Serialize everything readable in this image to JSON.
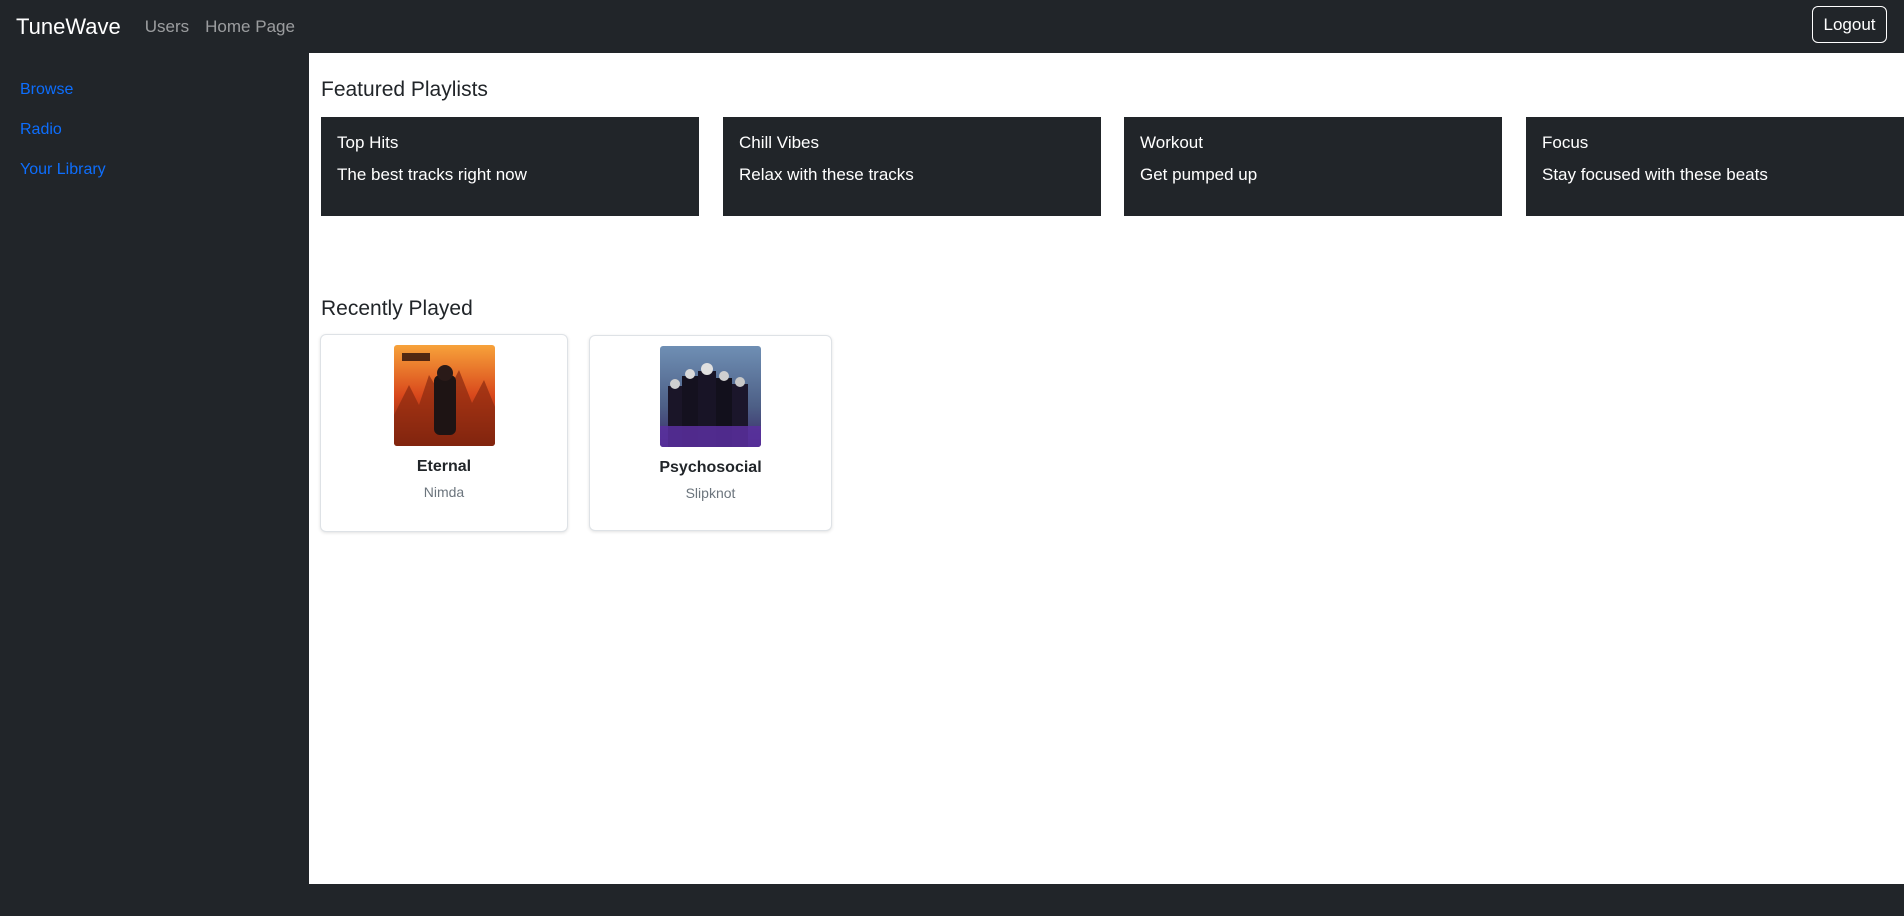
{
  "navbar": {
    "brand": "TuneWave",
    "links": [
      "Users",
      "Home Page"
    ],
    "logout_label": "Logout"
  },
  "sidebar": {
    "items": [
      {
        "label": "Browse"
      },
      {
        "label": "Radio"
      },
      {
        "label": "Your Library"
      }
    ]
  },
  "featured": {
    "title": "Featured Playlists",
    "playlists": [
      {
        "title": "Top Hits",
        "description": "The best tracks right now"
      },
      {
        "title": "Chill Vibes",
        "description": "Relax with these tracks"
      },
      {
        "title": "Workout",
        "description": "Get pumped up"
      },
      {
        "title": "Focus",
        "description": "Stay focused with these beats"
      }
    ]
  },
  "recent": {
    "title": "Recently Played",
    "tracks": [
      {
        "title": "Eternal",
        "artist": "Nimda"
      },
      {
        "title": "Psychosocial",
        "artist": "Slipknot"
      }
    ]
  },
  "colors": {
    "dark": "#212529",
    "link": "#0d6efd",
    "muted": "#6c757d"
  }
}
